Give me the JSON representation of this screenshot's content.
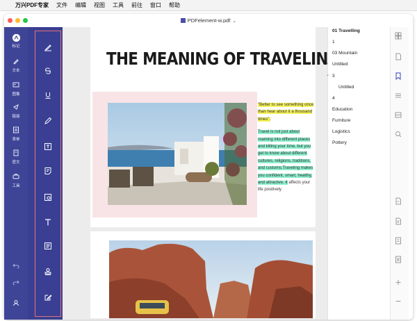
{
  "menubar": {
    "apple_glyph": "",
    "items": [
      "万兴PDF专家",
      "文件",
      "编辑",
      "视图",
      "工具",
      "前往",
      "窗口",
      "帮助"
    ]
  },
  "window": {
    "document_title": "PDFelement-w.pdf",
    "traffic_lights": {
      "close": "#fe5f57",
      "minimize": "#febc2e",
      "zoom": "#28c840"
    }
  },
  "rail": {
    "items": [
      {
        "label": "标记",
        "icon": "annotate-icon"
      },
      {
        "label": "文本",
        "icon": "pen-icon"
      },
      {
        "label": "图像",
        "icon": "image-icon"
      },
      {
        "label": "链接",
        "icon": "link-icon"
      },
      {
        "label": "表单",
        "icon": "form-icon"
      },
      {
        "label": "密文",
        "icon": "redact-icon"
      },
      {
        "label": "工具",
        "icon": "tools-icon"
      }
    ],
    "bottom": [
      "undo-icon",
      "redo-icon",
      "account-icon"
    ]
  },
  "toolbar": {
    "tools": [
      "highlight-icon",
      "strikethrough-icon",
      "underline-icon",
      "pencil-icon",
      "textbox-icon",
      "note-icon",
      "shape-icon",
      "typewriter-icon",
      "comment-list-icon",
      "stamp-icon",
      "signature-icon"
    ]
  },
  "document": {
    "heading": "THE MEANING OF TRAVELING",
    "quote": "\"Better to see something once than hear about it a thousand times\".",
    "body_highlighted": "Travel is not just about roaming into different places and killing your time, but you get to know about different cultures, religions, traditions, and customs.Traveling makes you confident, smart, healthy, and attractive. It",
    "body_plain": "affects your life positively"
  },
  "outline": {
    "items": [
      {
        "label": "01 Travelling",
        "indent": 0
      },
      {
        "label": "1",
        "indent": 0
      },
      {
        "label": "03 Mountain",
        "indent": 0
      },
      {
        "label": "Untitled",
        "indent": 0,
        "arrow": "›"
      },
      {
        "label": "3",
        "indent": 0,
        "arrow": "⌄"
      },
      {
        "label": "Untitled",
        "indent": 1
      },
      {
        "label": "4",
        "indent": 0
      },
      {
        "label": "Education",
        "indent": 0
      },
      {
        "label": "Furniture",
        "indent": 0
      },
      {
        "label": "Logistics",
        "indent": 0
      },
      {
        "label": "Pottery",
        "indent": 0
      }
    ]
  },
  "right_icons": [
    "thumbnails-icon",
    "page-icon",
    "bookmark-icon",
    "outline-icon",
    "attachment-icon",
    "search-icon",
    "convert-icon",
    "export-icon",
    "ocr-icon",
    "ocr-text-icon",
    "zoom-in-icon",
    "zoom-out-icon"
  ],
  "colors": {
    "rail": "#3f4596",
    "toolbar": "#3a3f93",
    "highlight_yellow": "#f5f25a",
    "highlight_green": "#8df0cf",
    "accent": "#5a5fc8"
  }
}
